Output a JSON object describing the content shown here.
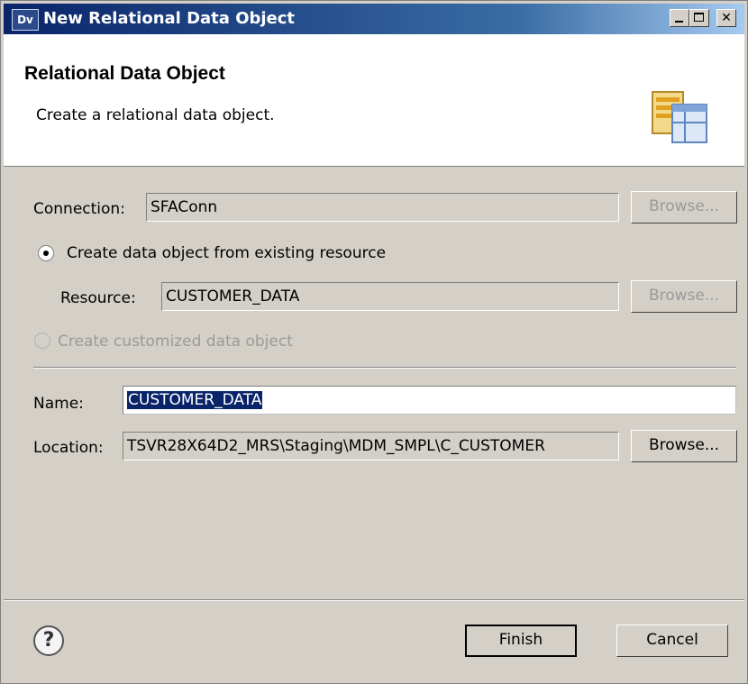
{
  "window": {
    "title": "New Relational Data Object",
    "icon_label": "Dv"
  },
  "banner": {
    "title": "Relational Data Object",
    "description": "Create a relational data object."
  },
  "connection": {
    "label": "Connection:",
    "value": "SFAConn",
    "browse_label": "Browse..."
  },
  "options": {
    "existing_label": "Create data object from existing resource",
    "existing_selected": true,
    "customized_label": "Create customized data object",
    "customized_enabled": false
  },
  "resource": {
    "label": "Resource:",
    "value": "CUSTOMER_DATA",
    "browse_label": "Browse..."
  },
  "name": {
    "label": "Name:",
    "value": "CUSTOMER_DATA"
  },
  "location": {
    "label": "Location:",
    "value": "TSVR28X64D2_MRS\\Staging\\MDM_SMPL\\C_CUSTOMER",
    "browse_label": "Browse..."
  },
  "footer": {
    "help_icon": "help-icon",
    "finish_label": "Finish",
    "cancel_label": "Cancel"
  },
  "colors": {
    "title_bar": "#0a246a",
    "selection": "#0a246a",
    "dialog_bg": "#d4d0c8"
  }
}
